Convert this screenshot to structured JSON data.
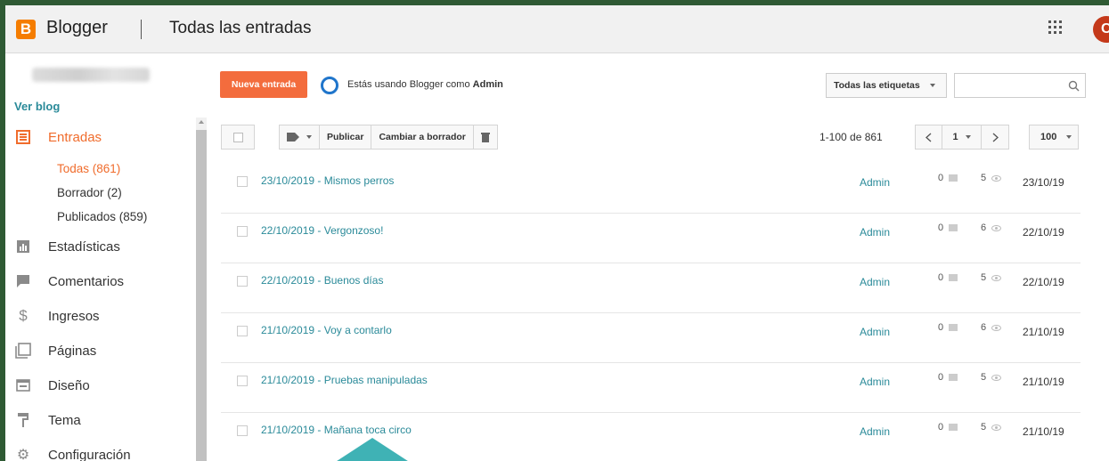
{
  "header": {
    "brand": "Blogger",
    "title": "Todas las entradas",
    "avatar_letter": "C",
    "logo_letter": "B"
  },
  "sidebar": {
    "view_blog": "Ver blog",
    "items": [
      {
        "label": "Entradas",
        "icon": "posts-icon",
        "active": true
      },
      {
        "label": "Estadísticas",
        "icon": "stats-icon"
      },
      {
        "label": "Comentarios",
        "icon": "comments-icon"
      },
      {
        "label": "Ingresos",
        "icon": "dollar-icon"
      },
      {
        "label": "Páginas",
        "icon": "pages-icon"
      },
      {
        "label": "Diseño",
        "icon": "layout-icon"
      },
      {
        "label": "Tema",
        "icon": "paint-roller-icon"
      },
      {
        "label": "Configuración",
        "icon": "gear-icon"
      }
    ],
    "sub_items": [
      {
        "label": "Todas (861)",
        "active": true
      },
      {
        "label": "Borrador (2)"
      },
      {
        "label": "Publicados (859)"
      }
    ]
  },
  "main": {
    "new_post": "Nueva entrada",
    "admin_note_prefix": "Estás usando Blogger como",
    "admin_role": "Admin",
    "labels_filter": "Todas las etiquetas",
    "search_placeholder": ""
  },
  "toolbar": {
    "publish": "Publicar",
    "to_draft": "Cambiar a borrador",
    "range": "1-100 de 861",
    "page": "1",
    "per_page": "100"
  },
  "posts": [
    {
      "title": "23/10/2019 - Mismos perros",
      "author": "Admin",
      "comments": "0",
      "views": "5",
      "date": "23/10/19"
    },
    {
      "title": "22/10/2019 - Vergonzoso!",
      "author": "Admin",
      "comments": "0",
      "views": "6",
      "date": "22/10/19"
    },
    {
      "title": "22/10/2019 - Buenos días",
      "author": "Admin",
      "comments": "0",
      "views": "5",
      "date": "22/10/19"
    },
    {
      "title": "21/10/2019 - Voy a contarlo",
      "author": "Admin",
      "comments": "0",
      "views": "6",
      "date": "21/10/19"
    },
    {
      "title": "21/10/2019 - Pruebas manipuladas",
      "author": "Admin",
      "comments": "0",
      "views": "5",
      "date": "21/10/19"
    },
    {
      "title": "21/10/2019 - Mañana toca circo",
      "author": "Admin",
      "comments": "0",
      "views": "5",
      "date": "21/10/19"
    }
  ],
  "colors": {
    "accent": "#f06c2c",
    "link": "#2a8a99",
    "frame": "#2f5a34"
  }
}
